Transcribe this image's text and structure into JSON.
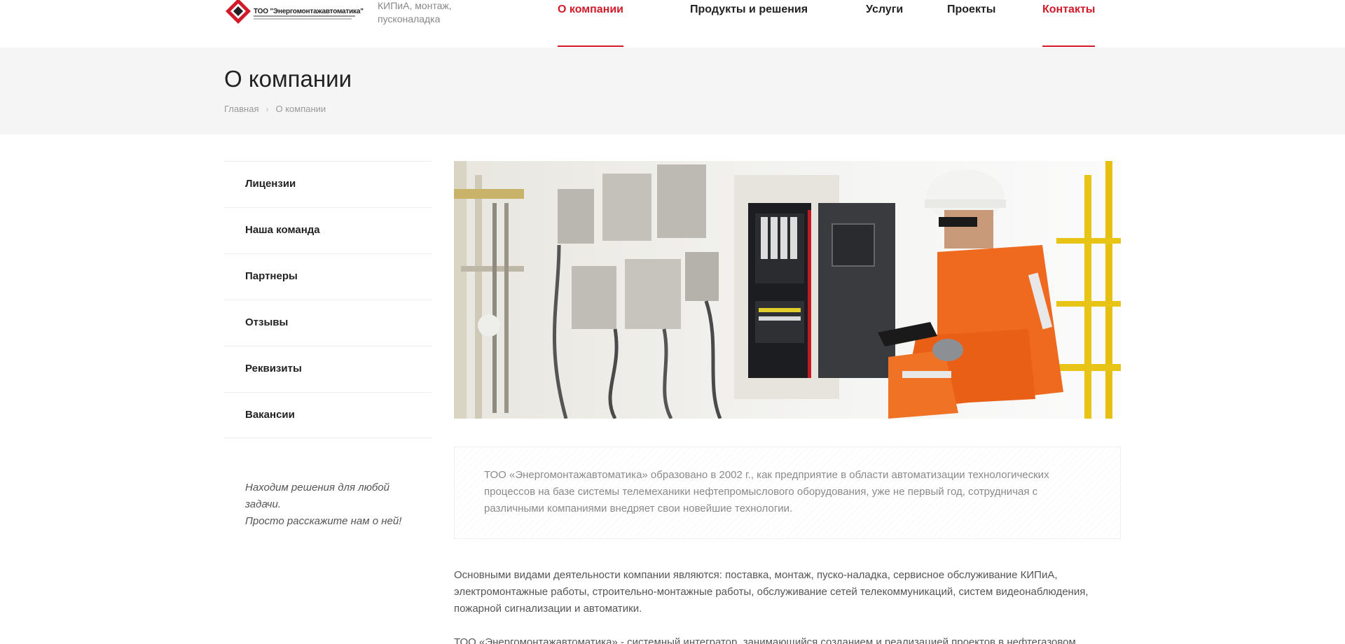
{
  "header": {
    "logo_text": "ТОО \"Энергомонтажавтоматика\"",
    "tagline": "КИПиА, монтаж, пусконаладка"
  },
  "nav": {
    "items": [
      {
        "label": "О компании",
        "active": true
      },
      {
        "label": "Продукты и решения",
        "active": false
      },
      {
        "label": "Услуги",
        "active": false
      },
      {
        "label": "Проекты",
        "active": false
      },
      {
        "label": "Контакты",
        "active": false
      }
    ]
  },
  "page": {
    "title": "О компании",
    "breadcrumb": {
      "home": "Главная",
      "current": "О компании"
    }
  },
  "sidebar": {
    "items": [
      {
        "label": "Лицензии"
      },
      {
        "label": "Наша команда"
      },
      {
        "label": "Партнеры"
      },
      {
        "label": "Отзывы"
      },
      {
        "label": "Реквизиты"
      },
      {
        "label": "Вакансии"
      }
    ],
    "note_line1": "Находим решения для любой задачи.",
    "note_line2": "Просто расскажите нам о ней!"
  },
  "content": {
    "quote": "ТОО «Энергомонтажавтоматика» образовано в 2002 г., как предприятие в области автоматизации технологических процессов на базе системы телемеханики нефтепромыслового оборудования, уже не первый год, сотрудничая с различными компаниями внедряет свои новейшие технологии.",
    "paragraph1": "Основными видами деятельности компании являются: поставка, монтаж, пуско-наладка, сервисное обслуживание КИПиА, электромонтажные работы, строительно-монтажные работы, обслуживание сетей телекоммуникаций, систем видеонаблюдения, пожарной сигнализации и автоматики.",
    "paragraph2": "ТОО «Энергомонтажавтоматика» - системный интегратор, занимающийся созданием и реализацией проектов в нефтегазовом"
  },
  "colors": {
    "accent": "#d11a2a",
    "band": "#f5f5f5"
  }
}
